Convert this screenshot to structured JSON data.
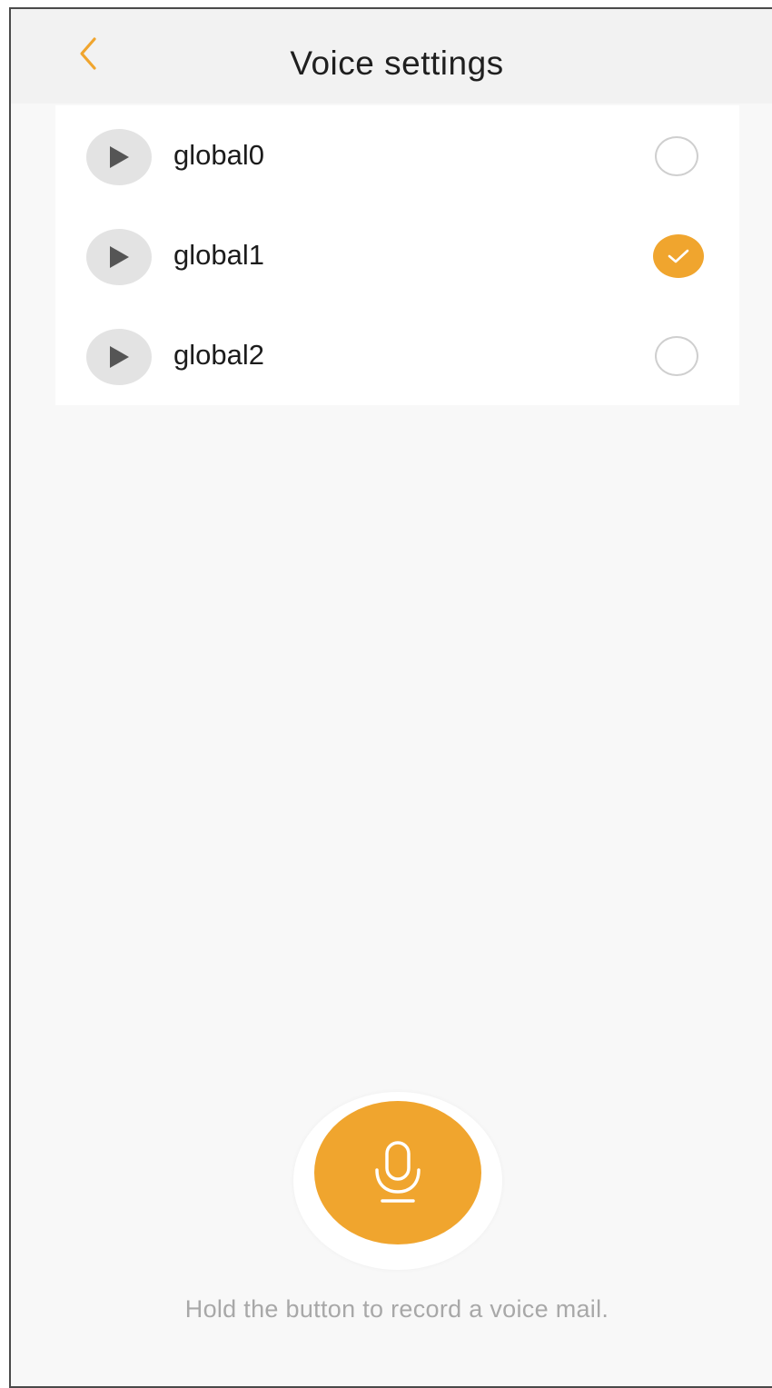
{
  "header": {
    "title": "Voice settings",
    "back_icon": "chevron-left-icon"
  },
  "voices": [
    {
      "label": "global0",
      "selected": false
    },
    {
      "label": "global1",
      "selected": true
    },
    {
      "label": "global2",
      "selected": false
    }
  ],
  "record": {
    "icon": "microphone-icon",
    "hint": "Hold the button to record a voice mail."
  },
  "colors": {
    "accent": "#f0a52e",
    "background": "#f8f8f8",
    "play_bg": "#e3e3e3"
  }
}
